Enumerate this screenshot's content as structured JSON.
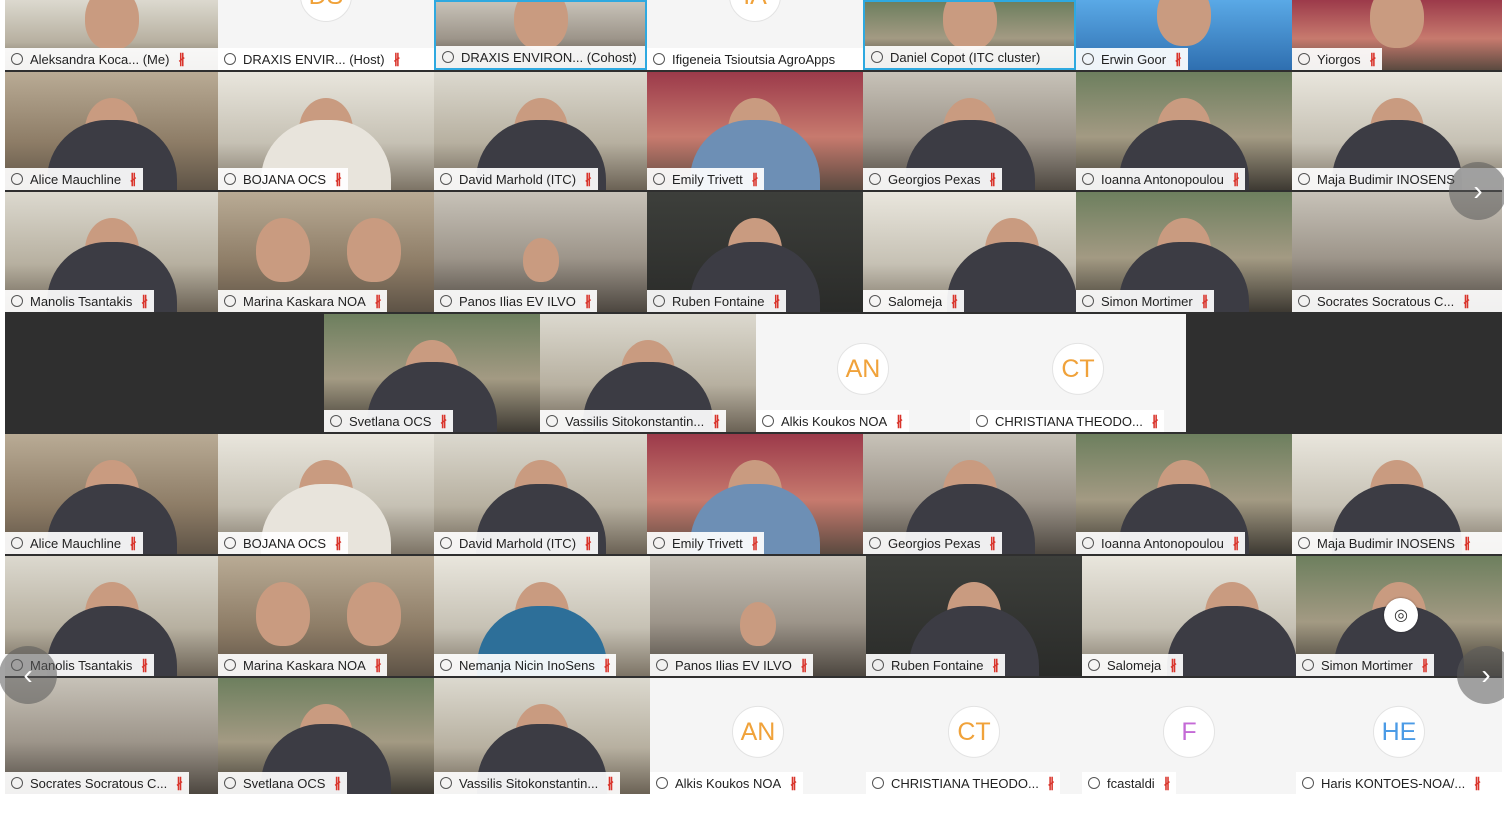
{
  "participants": [
    {
      "name": "Aleksandra Koca... (Me)",
      "kind": "video",
      "muted": true
    },
    {
      "name": "DRAXIS ENVIR... (Host)",
      "kind": "avatar",
      "initials": "DS",
      "muted": true
    },
    {
      "name": "DRAXIS ENVIRON... (Cohost)",
      "kind": "video",
      "muted": false
    },
    {
      "name": "Ifigeneia Tsioutsia AgroApps",
      "kind": "avatar",
      "initials": "IA",
      "muted": false
    },
    {
      "name": "Daniel Copot (ITC cluster)",
      "kind": "video",
      "muted": false
    },
    {
      "name": "Erwin Goor",
      "kind": "video",
      "muted": true
    },
    {
      "name": "Yiorgos",
      "kind": "video",
      "muted": true
    },
    {
      "name": "Alice Mauchline",
      "kind": "video",
      "muted": true
    },
    {
      "name": "BOJANA OCS",
      "kind": "video",
      "muted": true
    },
    {
      "name": "David Marhold (ITC)",
      "kind": "video",
      "muted": true
    },
    {
      "name": "Emily Trivett",
      "kind": "video",
      "muted": true
    },
    {
      "name": "Georgios Pexas",
      "kind": "video",
      "muted": true
    },
    {
      "name": "Ioanna Antonopoulou",
      "kind": "video",
      "muted": true
    },
    {
      "name": "Maja Budimir INOSENS",
      "kind": "video",
      "muted": true
    },
    {
      "name": "Manolis Tsantakis",
      "kind": "video",
      "muted": true
    },
    {
      "name": "Marina Kaskara NOA",
      "kind": "video",
      "muted": true
    },
    {
      "name": "Panos Ilias EV ILVO",
      "kind": "video",
      "muted": true
    },
    {
      "name": "Ruben Fontaine",
      "kind": "video",
      "muted": true
    },
    {
      "name": "Salomeja",
      "kind": "video",
      "muted": true
    },
    {
      "name": "Simon Mortimer",
      "kind": "video",
      "muted": true
    },
    {
      "name": "Socrates Socratous C...",
      "kind": "video",
      "muted": true
    },
    {
      "name": "Svetlana OCS",
      "kind": "video",
      "muted": true
    },
    {
      "name": "Vassilis Sitokonstantin...",
      "kind": "video",
      "muted": true
    },
    {
      "name": "Alkis Koukos NOA",
      "kind": "avatar",
      "initials": "AN",
      "muted": true
    },
    {
      "name": "CHRISTIANA THEODO...",
      "kind": "avatar",
      "initials": "CT",
      "muted": true
    },
    {
      "name": "Alice Mauchline",
      "kind": "video",
      "muted": true
    },
    {
      "name": "BOJANA OCS",
      "kind": "video",
      "muted": true
    },
    {
      "name": "David Marhold (ITC)",
      "kind": "video",
      "muted": true
    },
    {
      "name": "Emily Trivett",
      "kind": "video",
      "muted": true
    },
    {
      "name": "Georgios Pexas",
      "kind": "video",
      "muted": true
    },
    {
      "name": "Ioanna Antonopoulou",
      "kind": "video",
      "muted": true
    },
    {
      "name": "Maja Budimir INOSENS",
      "kind": "video",
      "muted": true
    },
    {
      "name": "Manolis Tsantakis",
      "kind": "video",
      "muted": true
    },
    {
      "name": "Marina Kaskara NOA",
      "kind": "video",
      "muted": true
    },
    {
      "name": "Nemanja Nicin InoSens",
      "kind": "video",
      "muted": true
    },
    {
      "name": "Panos Ilias EV ILVO",
      "kind": "video",
      "muted": true
    },
    {
      "name": "Ruben Fontaine",
      "kind": "video",
      "muted": true
    },
    {
      "name": "Salomeja",
      "kind": "video",
      "muted": true
    },
    {
      "name": "Simon Mortimer",
      "kind": "video",
      "muted": true
    },
    {
      "name": "Socrates Socratous C...",
      "kind": "video",
      "muted": true
    },
    {
      "name": "Svetlana OCS",
      "kind": "video",
      "muted": true
    },
    {
      "name": "Vassilis Sitokonstantin...",
      "kind": "video",
      "muted": true
    },
    {
      "name": "Alkis Koukos NOA",
      "kind": "avatar",
      "initials": "AN",
      "muted": true
    },
    {
      "name": "CHRISTIANA THEODO...",
      "kind": "avatar",
      "initials": "CT",
      "muted": true
    },
    {
      "name": "fcastaldi",
      "kind": "avatar",
      "initials": "F",
      "muted": true
    },
    {
      "name": "Haris KONTOES-NOA/...",
      "kind": "avatar",
      "initials": "HE",
      "muted": true
    }
  ],
  "nav": {
    "prev_icon": "‹",
    "next_icon": "›"
  },
  "colors": {
    "highlight": "#2ea9e0",
    "muted_mic": "#d9342b",
    "avatar_orange": "#f0a23a",
    "avatar_blue": "#4b9be6",
    "avatar_purple": "#c46ad6"
  }
}
